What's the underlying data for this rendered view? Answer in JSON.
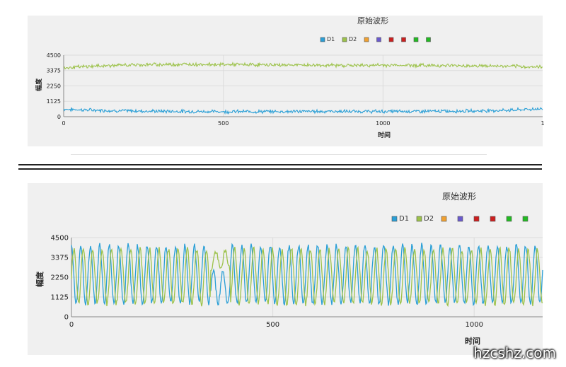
{
  "colors": {
    "series": [
      "#2a9fd6",
      "#9cc24a",
      "#f0a030",
      "#6a5acd",
      "#cc1f1f",
      "#cc1f1f",
      "#22bb22",
      "#22bb22"
    ],
    "grid": "#dcdcdc",
    "axis": "#888888"
  },
  "chart_data": [
    {
      "type": "line",
      "title": "原始波形",
      "xlabel": "时间",
      "ylabel": "幅度",
      "xlim": [
        0,
        1500
      ],
      "ylim": [
        0,
        4500
      ],
      "x_ticks": [
        "0",
        "500",
        "1000",
        "1"
      ],
      "y_ticks": [
        "0",
        "1125",
        "2250",
        "3375",
        "4500"
      ],
      "grid": true,
      "legend_position": "top-right",
      "series": [
        {
          "name": "D1",
          "x": [
            0,
            100,
            200,
            300,
            400,
            500,
            600,
            700,
            800,
            900,
            1000,
            1100,
            1200,
            1300,
            1400,
            1500
          ],
          "values": [
            550,
            470,
            420,
            400,
            380,
            370,
            370,
            380,
            390,
            380,
            380,
            390,
            400,
            430,
            480,
            580
          ]
        },
        {
          "name": "D2",
          "x": [
            0,
            100,
            200,
            300,
            400,
            500,
            600,
            700,
            800,
            900,
            1000,
            1100,
            1200,
            1300,
            1400,
            1500
          ],
          "values": [
            3580,
            3700,
            3780,
            3820,
            3830,
            3820,
            3800,
            3780,
            3760,
            3750,
            3760,
            3760,
            3740,
            3720,
            3680,
            3620
          ]
        },
        {
          "name": "",
          "values": []
        },
        {
          "name": "",
          "values": []
        },
        {
          "name": "",
          "values": []
        },
        {
          "name": "",
          "values": []
        },
        {
          "name": "",
          "values": []
        },
        {
          "name": "",
          "values": []
        }
      ]
    },
    {
      "type": "line",
      "title": "原始波形",
      "xlabel": "时间",
      "ylabel": "幅度",
      "xlim": [
        0,
        1170
      ],
      "ylim": [
        0,
        4500
      ],
      "x_ticks": [
        "0",
        "500",
        "1000"
      ],
      "y_ticks": [
        "0",
        "1125",
        "2250",
        "3375",
        "4500"
      ],
      "grid": true,
      "legend_position": "top-right",
      "period": 23.5,
      "series": [
        {
          "name": "D1",
          "amplitude": 1650,
          "offset": 2400,
          "phase_shift": 0.25
        },
        {
          "name": "D2",
          "amplitude": 1550,
          "offset": 2300,
          "phase_shift": 0
        },
        {
          "name": "",
          "values": []
        },
        {
          "name": "",
          "values": []
        },
        {
          "name": "",
          "values": []
        },
        {
          "name": "",
          "values": []
        },
        {
          "name": "",
          "values": []
        },
        {
          "name": "",
          "values": []
        }
      ]
    }
  ],
  "watermark": "hzcshz.com"
}
